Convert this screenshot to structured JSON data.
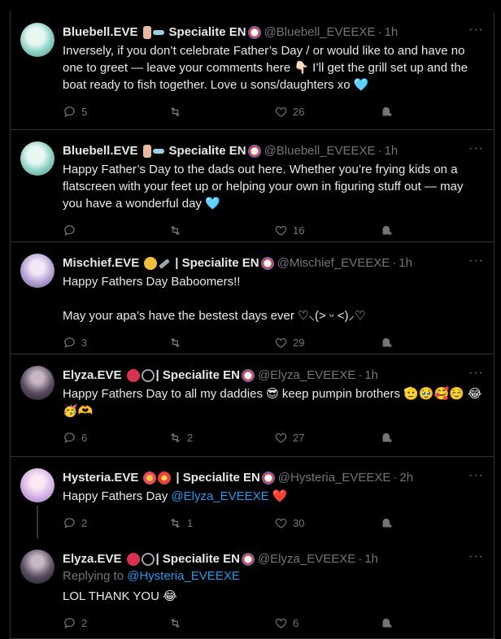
{
  "tweets": [
    {
      "name": "Bluebell.EVE",
      "tag": "Specialite EN",
      "handle": "@Bluebell_EVEEXE",
      "time": "1h",
      "text": [
        "Inversely, if you don’t celebrate Father’s Day / or would like to and have no one to greet — leave your comments here 👇🏻 I’ll get the grill set up and the boat ready to fish together. Love u sons/daughters xo 🩵"
      ],
      "replies": "5",
      "retweets": "",
      "likes": "26",
      "avatar_color": "#8fd3c8"
    },
    {
      "name": "Bluebell.EVE",
      "tag": "Specialite EN",
      "handle": "@Bluebell_EVEEXE",
      "time": "1h",
      "text": [
        "Happy Father’s Day to the dads out here. Whether you’re frying kids on a flatscreen with your feet up or helping your own in figuring stuff out — may you have a wonderful day 🩵"
      ],
      "replies": "",
      "retweets": "",
      "likes": "16",
      "avatar_color": "#8fd3c8"
    },
    {
      "name": "Mischief.EVE",
      "tag": "| Specialite EN",
      "handle": "@Mischief_EVEEXE",
      "time": "1h",
      "text": [
        "Happy Fathers Day Baboomers!!",
        "",
        "May your apa’s have the bestest days ever ♡⸜(˃ ᵕ ˂)⸝♡"
      ],
      "replies": "3",
      "retweets": "",
      "likes": "29",
      "avatar_color": "#b9a6d8"
    },
    {
      "name": "Elyza.EVE",
      "tag": "| Specialite EN",
      "handle": "@Elyza_EVEEXE",
      "time": "1h",
      "text": [
        "Happy Fathers Day to all my daddies 😎 keep pumpin brothers 🫡🥹🥰☺️ 😂🥳🫶"
      ],
      "replies": "6",
      "retweets": "2",
      "likes": "27",
      "avatar_color": "#5a4d63"
    },
    {
      "name": "Hysteria.EVE",
      "tag": "| Specialite EN",
      "handle": "@Hysteria_EVEEXE",
      "time": "2h",
      "text_prefix": "Happy Fathers Day ",
      "mention": "@Elyza_EVEEXE",
      "text_suffix": " ❤️",
      "replies": "2",
      "retweets": "1",
      "likes": "30",
      "avatar_color": "#d8b6e6"
    },
    {
      "name": "Elyza.EVE",
      "tag": "| Specialite EN",
      "handle": "@Elyza_EVEEXE",
      "time": "1h",
      "replying_label": "Replying to ",
      "replying_to": "@Hysteria_EVEEXE",
      "text": [
        "LOL THANK YOU 😂"
      ],
      "replies": "2",
      "retweets": "",
      "likes": "6",
      "avatar_color": "#5a4d63"
    }
  ],
  "dot": "·",
  "more": "···"
}
